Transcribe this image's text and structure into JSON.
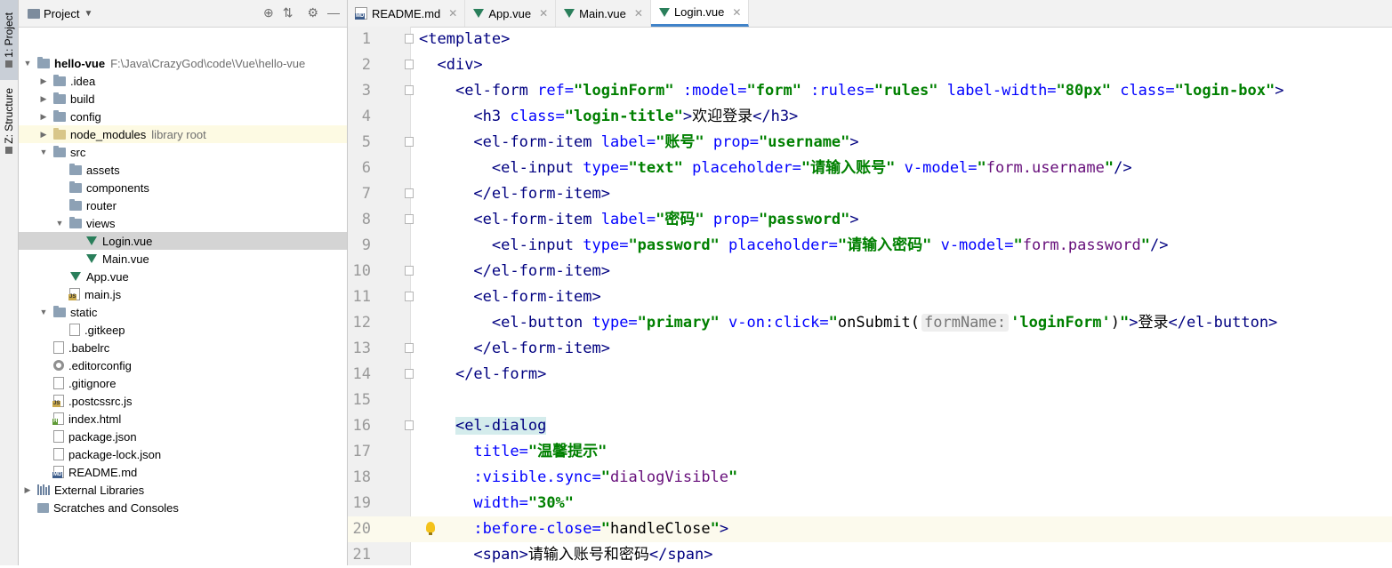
{
  "stripe": {
    "project_tab": "1: Project",
    "structure_tab": "Z: Structure"
  },
  "project_panel": {
    "title": "Project",
    "tree": [
      {
        "label": "hello-vue",
        "extra": "F:\\Java\\CrazyGod\\code\\Vue\\hello-vue",
        "depth": 0,
        "icon": "folder-icon",
        "expanded": true,
        "bold": true
      },
      {
        "label": ".idea",
        "depth": 1,
        "icon": "folder-icon",
        "expanded": false
      },
      {
        "label": "build",
        "depth": 1,
        "icon": "folder-icon",
        "expanded": false
      },
      {
        "label": "config",
        "depth": 1,
        "icon": "folder-icon",
        "expanded": false
      },
      {
        "label": "node_modules",
        "extra": "library root",
        "depth": 1,
        "icon": "folder-icon",
        "expanded": false,
        "highlight": true
      },
      {
        "label": "src",
        "depth": 1,
        "icon": "folder-icon",
        "expanded": true
      },
      {
        "label": "assets",
        "depth": 2,
        "icon": "folder-icon"
      },
      {
        "label": "components",
        "depth": 2,
        "icon": "folder-icon"
      },
      {
        "label": "router",
        "depth": 2,
        "icon": "folder-icon"
      },
      {
        "label": "views",
        "depth": 2,
        "icon": "folder-icon",
        "expanded": true
      },
      {
        "label": "Login.vue",
        "depth": 3,
        "icon": "vue-icon",
        "selected": true
      },
      {
        "label": "Main.vue",
        "depth": 3,
        "icon": "vue-icon"
      },
      {
        "label": "App.vue",
        "depth": 2,
        "icon": "vue-icon"
      },
      {
        "label": "main.js",
        "depth": 2,
        "icon": "js-file-icon"
      },
      {
        "label": "static",
        "depth": 1,
        "icon": "folder-icon",
        "expanded": true
      },
      {
        "label": ".gitkeep",
        "depth": 2,
        "icon": "file-icon"
      },
      {
        "label": ".babelrc",
        "depth": 1,
        "icon": "file-icon"
      },
      {
        "label": ".editorconfig",
        "depth": 1,
        "icon": "gear-file-icon"
      },
      {
        "label": ".gitignore",
        "depth": 1,
        "icon": "file-icon"
      },
      {
        "label": ".postcssrc.js",
        "depth": 1,
        "icon": "js-file-icon"
      },
      {
        "label": "index.html",
        "depth": 1,
        "icon": "html-file-icon"
      },
      {
        "label": "package.json",
        "depth": 1,
        "icon": "file-icon"
      },
      {
        "label": "package-lock.json",
        "depth": 1,
        "icon": "file-icon"
      },
      {
        "label": "README.md",
        "depth": 1,
        "icon": "md-file-icon"
      },
      {
        "label": "External Libraries",
        "depth": 0,
        "icon": "library-icon",
        "expanded": false
      },
      {
        "label": "Scratches and Consoles",
        "depth": 0,
        "icon": "scratch-icon"
      }
    ]
  },
  "tabs": [
    {
      "label": "README.md",
      "icon": "md-file-icon",
      "active": false
    },
    {
      "label": "App.vue",
      "icon": "vue-icon",
      "active": false
    },
    {
      "label": "Main.vue",
      "icon": "vue-icon",
      "active": false
    },
    {
      "label": "Login.vue",
      "icon": "vue-icon",
      "active": true
    }
  ],
  "editor": {
    "current_line": 20,
    "lines": [
      {
        "n": "1",
        "tokens": [
          [
            "t",
            "<template>"
          ]
        ]
      },
      {
        "n": "2",
        "tokens": [
          [
            "p",
            "  "
          ],
          [
            "t",
            "<div>"
          ]
        ]
      },
      {
        "n": "3",
        "tokens": [
          [
            "p",
            "    "
          ],
          [
            "t",
            "<el-form "
          ],
          [
            "a",
            "ref="
          ],
          [
            "v",
            "\"loginForm\" "
          ],
          [
            "a",
            ":model="
          ],
          [
            "v",
            "\"form\" "
          ],
          [
            "a",
            ":rules="
          ],
          [
            "v",
            "\"rules\" "
          ],
          [
            "a",
            "label-width="
          ],
          [
            "v",
            "\"80px\" "
          ],
          [
            "a",
            "class="
          ],
          [
            "v",
            "\"login-box\""
          ],
          [
            "t",
            ">"
          ]
        ]
      },
      {
        "n": "4",
        "tokens": [
          [
            "p",
            "      "
          ],
          [
            "t",
            "<h3 "
          ],
          [
            "a",
            "class="
          ],
          [
            "v",
            "\"login-title\""
          ],
          [
            "t",
            ">"
          ],
          [
            "zh",
            "欢迎登录"
          ],
          [
            "t",
            "</h3>"
          ]
        ]
      },
      {
        "n": "5",
        "tokens": [
          [
            "p",
            "      "
          ],
          [
            "t",
            "<el-form-item "
          ],
          [
            "a",
            "label="
          ],
          [
            "v",
            "\"账号\" "
          ],
          [
            "a",
            "prop="
          ],
          [
            "v",
            "\"username\""
          ],
          [
            "t",
            ">"
          ]
        ]
      },
      {
        "n": "6",
        "tokens": [
          [
            "p",
            "        "
          ],
          [
            "t",
            "<el-input "
          ],
          [
            "a",
            "type="
          ],
          [
            "v",
            "\"text\" "
          ],
          [
            "a",
            "placeholder="
          ],
          [
            "v",
            "\"请输入账号\" "
          ],
          [
            "a",
            "v-model="
          ],
          [
            "v",
            "\""
          ],
          [
            "vm",
            "form.username"
          ],
          [
            "v",
            "\""
          ],
          [
            "t",
            "/>"
          ]
        ]
      },
      {
        "n": "7",
        "tokens": [
          [
            "p",
            "      "
          ],
          [
            "t",
            "</el-form-item>"
          ]
        ]
      },
      {
        "n": "8",
        "tokens": [
          [
            "p",
            "      "
          ],
          [
            "t",
            "<el-form-item "
          ],
          [
            "a",
            "label="
          ],
          [
            "v",
            "\"密码\" "
          ],
          [
            "a",
            "prop="
          ],
          [
            "v",
            "\"password\""
          ],
          [
            "t",
            ">"
          ]
        ]
      },
      {
        "n": "9",
        "tokens": [
          [
            "p",
            "        "
          ],
          [
            "t",
            "<el-input "
          ],
          [
            "a",
            "type="
          ],
          [
            "v",
            "\"password\" "
          ],
          [
            "a",
            "placeholder="
          ],
          [
            "v",
            "\"请输入密码\" "
          ],
          [
            "a",
            "v-model="
          ],
          [
            "v",
            "\""
          ],
          [
            "vm",
            "form.password"
          ],
          [
            "v",
            "\""
          ],
          [
            "t",
            "/>"
          ]
        ]
      },
      {
        "n": "10",
        "tokens": [
          [
            "p",
            "      "
          ],
          [
            "t",
            "</el-form-item>"
          ]
        ]
      },
      {
        "n": "11",
        "tokens": [
          [
            "p",
            "      "
          ],
          [
            "t",
            "<el-form-item>"
          ]
        ]
      },
      {
        "n": "12",
        "tokens": [
          [
            "p",
            "        "
          ],
          [
            "t",
            "<el-button "
          ],
          [
            "a",
            "type="
          ],
          [
            "v",
            "\"primary\" "
          ],
          [
            "a",
            "v-on:click="
          ],
          [
            "v",
            "\""
          ],
          [
            "p",
            "onSubmit("
          ],
          [
            "hint",
            "formName:"
          ],
          [
            "v",
            "'loginForm'"
          ],
          [
            "p",
            ")"
          ],
          [
            "v",
            "\""
          ],
          [
            "t",
            ">"
          ],
          [
            "zh",
            "登录"
          ],
          [
            "t",
            "</el-button>"
          ]
        ]
      },
      {
        "n": "13",
        "tokens": [
          [
            "p",
            "      "
          ],
          [
            "t",
            "</el-form-item>"
          ]
        ]
      },
      {
        "n": "14",
        "tokens": [
          [
            "p",
            "    "
          ],
          [
            "t",
            "</el-form>"
          ]
        ]
      },
      {
        "n": "15",
        "tokens": []
      },
      {
        "n": "16",
        "tokens": [
          [
            "p",
            "    "
          ],
          [
            "tm",
            "<el-dialog"
          ]
        ]
      },
      {
        "n": "17",
        "tokens": [
          [
            "p",
            "      "
          ],
          [
            "a",
            "title="
          ],
          [
            "v",
            "\"温馨提示\""
          ]
        ]
      },
      {
        "n": "18",
        "tokens": [
          [
            "p",
            "      "
          ],
          [
            "a",
            ":visible.sync="
          ],
          [
            "v",
            "\""
          ],
          [
            "vm",
            "dialogVisible"
          ],
          [
            "v",
            "\""
          ]
        ]
      },
      {
        "n": "19",
        "tokens": [
          [
            "p",
            "      "
          ],
          [
            "a",
            "width="
          ],
          [
            "v",
            "\"30%\""
          ]
        ]
      },
      {
        "n": "20",
        "tokens": [
          [
            "p",
            "      "
          ],
          [
            "a",
            ":before-close="
          ],
          [
            "v",
            "\""
          ],
          [
            "p",
            "handleClose"
          ],
          [
            "v",
            "\""
          ],
          [
            "t",
            ">"
          ]
        ]
      },
      {
        "n": "21",
        "tokens": [
          [
            "p",
            "      "
          ],
          [
            "t",
            "<span>"
          ],
          [
            "zh",
            "请输入账号和密码"
          ],
          [
            "t",
            "</span>"
          ]
        ]
      }
    ]
  }
}
